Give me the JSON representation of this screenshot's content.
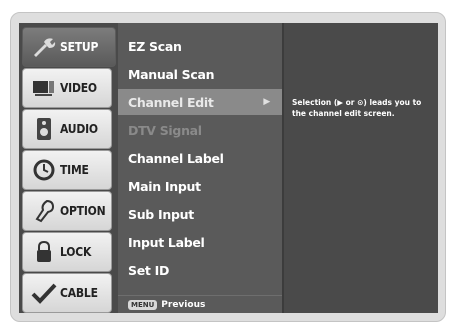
{
  "tabs": [
    {
      "label": "SETUP",
      "icon": "wrench-icon",
      "active": true
    },
    {
      "label": "VIDEO",
      "icon": "tv-icon",
      "active": false
    },
    {
      "label": "AUDIO",
      "icon": "speaker-icon",
      "active": false
    },
    {
      "label": "TIME",
      "icon": "clock-icon",
      "active": false
    },
    {
      "label": "OPTION",
      "icon": "option-icon",
      "active": false
    },
    {
      "label": "LOCK",
      "icon": "lock-icon",
      "active": false
    },
    {
      "label": "CABLE",
      "icon": "check-icon",
      "active": false
    }
  ],
  "menu": {
    "items": [
      {
        "label": "EZ Scan",
        "state": "normal"
      },
      {
        "label": "Manual Scan",
        "state": "normal"
      },
      {
        "label": "Channel Edit",
        "state": "selected",
        "arrow": "▶"
      },
      {
        "label": "DTV Signal",
        "state": "disabled"
      },
      {
        "label": "Channel Label",
        "state": "normal"
      },
      {
        "label": "Main Input",
        "state": "normal"
      },
      {
        "label": "Sub Input",
        "state": "normal"
      },
      {
        "label": "Input Label",
        "state": "normal"
      },
      {
        "label": "Set ID",
        "state": "normal"
      }
    ],
    "footer_key": "MENU",
    "footer_label": "Previous"
  },
  "help": {
    "text": "Selection (▶ or ⊙) leads you to the channel edit screen."
  },
  "colors": {
    "screen_bg": "#4a4a4a",
    "menu_bg": "#5a5a5a",
    "selected_bg": "#8a8a8a",
    "disabled_text": "#8a8a8a"
  }
}
